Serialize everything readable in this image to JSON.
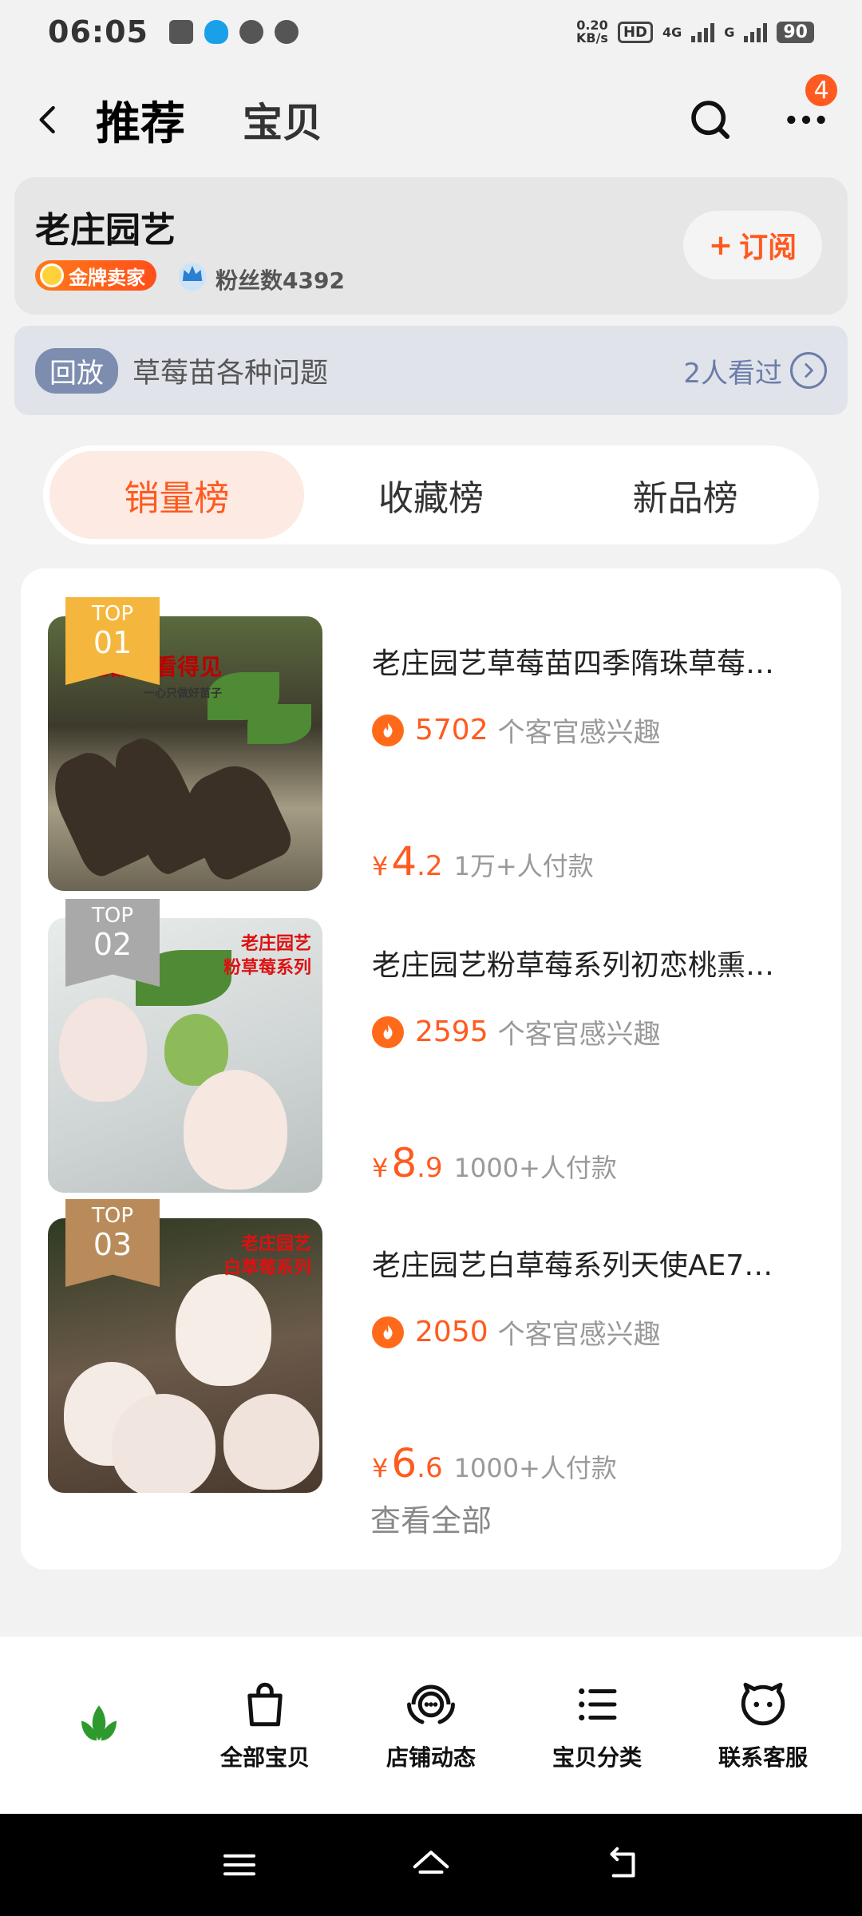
{
  "status": {
    "time": "06:05",
    "net_speed_top": "0.20",
    "net_speed_unit": "KB/s",
    "hd": "HD",
    "net1": "4G",
    "net2": "G",
    "battery": "90"
  },
  "nav": {
    "tab_active": "推荐",
    "tab_second": "宝贝",
    "badge_count": "4"
  },
  "shop": {
    "name": "老庄园艺",
    "badge": "金牌卖家",
    "fans": "粉丝数4392",
    "subscribe_label": "订阅",
    "subscribe_plus": "+"
  },
  "replay": {
    "tag": "回放",
    "title": "草莓苗各种问题",
    "viewed": "2人看过"
  },
  "rank_tabs": [
    "销量榜",
    "收藏榜",
    "新品榜"
  ],
  "products": [
    {
      "top_label": "TOP",
      "rank": "01",
      "title": "老庄园艺草莓苗四季隋珠草莓…",
      "heat": "5702",
      "heat_text": "个客官感兴趣",
      "yen": "¥",
      "price_int": "4",
      "price_dec": ".2",
      "sold": "1万+人付款",
      "img_caption_big": "艺品质看得见",
      "img_caption_small": "一心只做好苗子"
    },
    {
      "top_label": "TOP",
      "rank": "02",
      "title": "老庄园艺粉草莓系列初恋桃熏…",
      "heat": "2595",
      "heat_text": "个客官感兴趣",
      "yen": "¥",
      "price_int": "8",
      "price_dec": ".9",
      "sold": "1000+人付款",
      "img_caption_1": "老庄园艺",
      "img_caption_2": "粉草莓系列"
    },
    {
      "top_label": "TOP",
      "rank": "03",
      "title": "老庄园艺白草莓系列天使AE7…",
      "heat": "2050",
      "heat_text": "个客官感兴趣",
      "yen": "¥",
      "price_int": "6",
      "price_dec": ".6",
      "sold": "1000+人付款",
      "img_caption_1": "老庄园艺",
      "img_caption_2": "白草莓系列"
    }
  ],
  "see_all": "查看全部",
  "bottom_nav": [
    "全部宝贝",
    "店铺动态",
    "宝贝分类",
    "联系客服"
  ],
  "colors": {
    "accent": "#ff5a1f",
    "logo_green": "#2e9a2e",
    "replay_tag": "#7d8db0"
  }
}
